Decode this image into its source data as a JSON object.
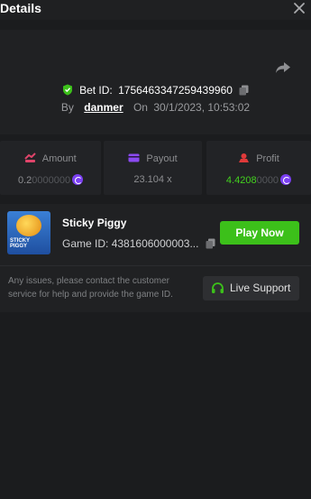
{
  "header": {
    "title": "Details",
    "close_icon": "close-icon"
  },
  "bet": {
    "share_icon": "share-icon",
    "bet_id_label": "Bet ID:",
    "bet_id": "1756463347259439960",
    "by_label": "By",
    "username": "danmer",
    "on_label": "On",
    "datetime": "30/1/2023, 10:53:02"
  },
  "stats": {
    "amount": {
      "label": "Amount",
      "value_main": "0.2",
      "value_dim": "0000000"
    },
    "payout": {
      "label": "Payout",
      "value": "23.104 x"
    },
    "profit": {
      "label": "Profit",
      "value_main": "4.4208",
      "value_dim": "0000"
    }
  },
  "game": {
    "name": "Sticky Piggy",
    "thumb_text": "STICKY PIGGY",
    "id_label": "Game ID:",
    "id_value": "4381606000003...",
    "play_label": "Play Now"
  },
  "support": {
    "issue_text": "Any issues, please contact the customer service for help and provide the game ID.",
    "button_label": "Live Support"
  },
  "colors": {
    "background": "#1b1c1e",
    "card": "#202123",
    "accent_green": "#3cc01a",
    "profit_green": "#43d11f",
    "coin_purple": "#7b3ff2"
  }
}
